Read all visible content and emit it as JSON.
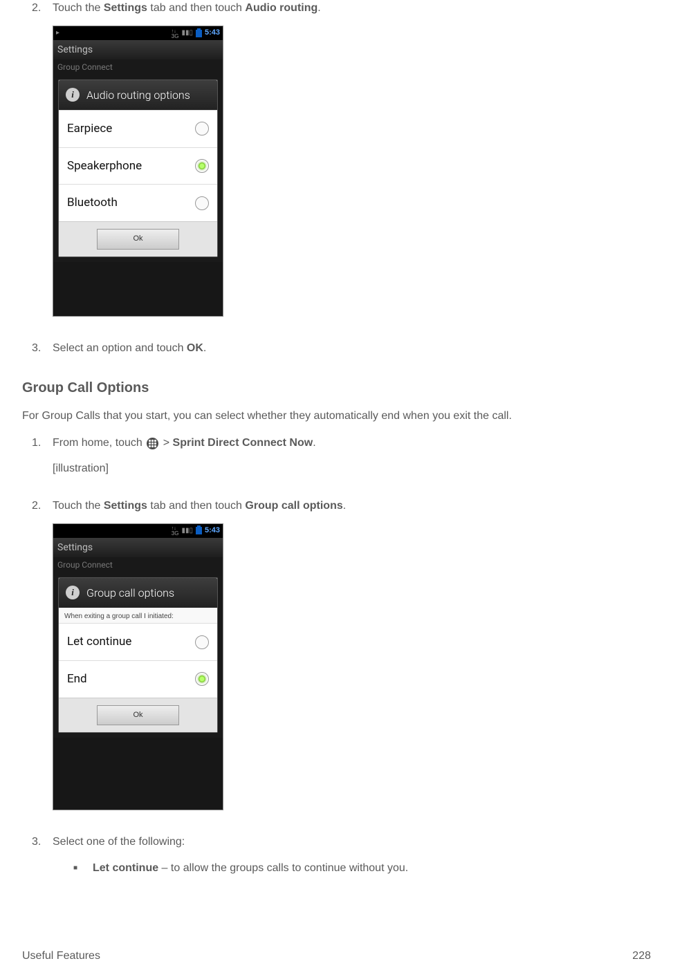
{
  "steps_audio": {
    "s2_num": "2.",
    "s2_a": "Touch the ",
    "s2_b": "Settings",
    "s2_c": " tab and then touch ",
    "s2_d": "Audio routing",
    "s2_e": ".",
    "s3_num": "3.",
    "s3_a": "Select an option and touch ",
    "s3_b": "OK",
    "s3_c": "."
  },
  "section_title": "Group Call Options",
  "section_para": "For Group Calls that you start, you can select whether they automatically end when you exit the call.",
  "steps_group": {
    "s1_num": "1.",
    "s1_a": "From home, touch ",
    "s1_b": " > ",
    "s1_c": "Sprint Direct Connect Now",
    "s1_d": ".",
    "s1_ill": "[illustration]",
    "s2_num": "2.",
    "s2_a": "Touch the ",
    "s2_b": "Settings",
    "s2_c": " tab and then touch ",
    "s2_d": "Group call options",
    "s2_e": ".",
    "s3_num": "3.",
    "s3_text": "Select one of the following:",
    "bullet_a": "Let continue",
    "bullet_b": " – to allow the groups calls to continue without you."
  },
  "phone1": {
    "net": "3G",
    "clock": "5:43",
    "title": "Settings",
    "sub": "Group Connect",
    "dlg_title": "Audio routing options",
    "opts": {
      "o1": "Earpiece",
      "o2": "Speakerphone",
      "o3": "Bluetooth"
    },
    "ok": "Ok"
  },
  "phone2": {
    "net": "3G",
    "clock": "5:43",
    "title": "Settings",
    "sub": "Group Connect",
    "dlg_title": "Group call options",
    "note": "When exiting a group call I initiated:",
    "opts": {
      "o1": "Let continue",
      "o2": "End"
    },
    "ok": "Ok"
  },
  "footer": {
    "left": "Useful Features",
    "right": "228"
  }
}
